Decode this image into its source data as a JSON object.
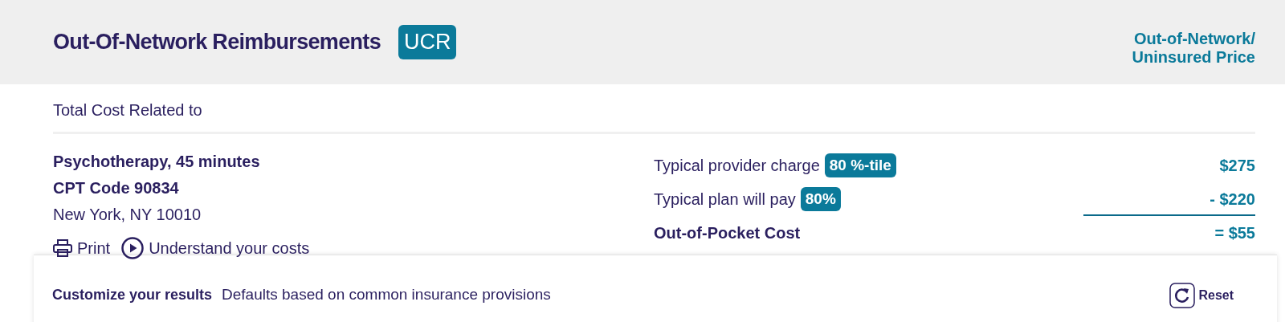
{
  "header": {
    "title": "Out-Of-Network Reimbursements",
    "badge": "UCR",
    "price_heading": [
      "Out-of-Network/",
      "Uninsured Price"
    ]
  },
  "subheading": "Total Cost Related to",
  "service": {
    "name": "Psychotherapy, 45 minutes",
    "code": "CPT Code 90834",
    "location": "New York, NY 10010"
  },
  "actions": [
    {
      "kind": "print",
      "label": "Print"
    },
    {
      "kind": "play",
      "label": "Understand your costs"
    }
  ],
  "cost_lines": [
    {
      "kind": "line",
      "label": "Typical provider charge",
      "badge": "80 %-tile",
      "amount": "$275"
    },
    {
      "kind": "line",
      "label": "Typical plan will pay",
      "badge": "80%",
      "amount": "- $220"
    },
    {
      "kind": "total",
      "label": "Out-of-Pocket Cost",
      "amount": "= $55"
    }
  ],
  "customize": {
    "title": "Customize your results",
    "note": "Defaults based on common insurance provisions",
    "reset": "Reset"
  }
}
